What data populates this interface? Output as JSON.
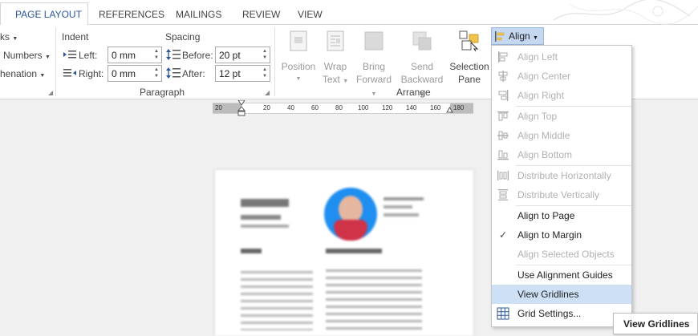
{
  "tabs": [
    {
      "label": "PAGE LAYOUT",
      "active": true
    },
    {
      "label": "REFERENCES"
    },
    {
      "label": "MAILINGS"
    },
    {
      "label": "REVIEW"
    },
    {
      "label": "VIEW"
    }
  ],
  "page_setup": {
    "breaks_label": "ks",
    "numbers_label": "Numbers",
    "hyphenation_label": "henation"
  },
  "paragraph": {
    "indent_title": "Indent",
    "left_label": "Left:",
    "left_value": "0 mm",
    "right_label": "Right:",
    "right_value": "0 mm",
    "spacing_title": "Spacing",
    "before_label": "Before:",
    "before_value": "20 pt",
    "after_label": "After:",
    "after_value": "12 pt",
    "group_label": "Paragraph"
  },
  "arrange": {
    "position_l1": "Position",
    "wrap_l1": "Wrap",
    "wrap_l2": "Text",
    "bring_l1": "Bring",
    "bring_l2": "Forward",
    "send_l1": "Send",
    "send_l2": "Backward",
    "selection_l1": "Selection",
    "selection_l2": "Pane",
    "group_label": "Arrange",
    "align_label": "Align"
  },
  "ruler": {
    "numbers": [
      "20",
      "20",
      "40",
      "60",
      "80",
      "100",
      "120",
      "140",
      "160",
      "180"
    ]
  },
  "align_menu": [
    {
      "label": "Align Left",
      "enabled": false,
      "icon": "align-left-icon"
    },
    {
      "label": "Align Center",
      "enabled": false,
      "icon": "align-center-icon"
    },
    {
      "label": "Align Right",
      "enabled": false,
      "icon": "align-right-icon"
    },
    {
      "label": "Align Top",
      "enabled": false,
      "icon": "align-top-icon"
    },
    {
      "label": "Align Middle",
      "enabled": false,
      "icon": "align-middle-icon"
    },
    {
      "label": "Align Bottom",
      "enabled": false,
      "icon": "align-bottom-icon"
    },
    {
      "label": "Distribute Horizontally",
      "enabled": false,
      "icon": "distribute-horizontally-icon"
    },
    {
      "label": "Distribute Vertically",
      "enabled": false,
      "icon": "distribute-vertically-icon"
    },
    {
      "label": "Align to Page",
      "enabled": true
    },
    {
      "label": "Align to Margin",
      "enabled": true,
      "checked": true
    },
    {
      "label": "Align Selected Objects",
      "enabled": false
    },
    {
      "label": "Use Alignment Guides",
      "enabled": true
    },
    {
      "label": "View Gridlines",
      "enabled": true,
      "hover": true
    },
    {
      "label": "Grid Settings...",
      "enabled": true,
      "icon": "grid-icon"
    }
  ],
  "tooltip": "View Gridlines",
  "colors": {
    "accent": "#2b579a",
    "menu_hover": "#cde0f5",
    "align_button": "#c5d8f0"
  }
}
